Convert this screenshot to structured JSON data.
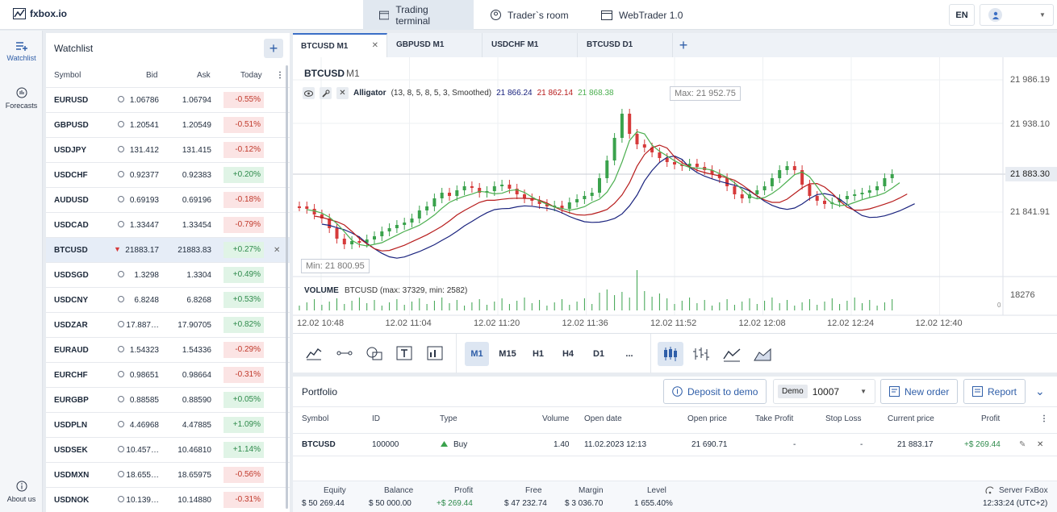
{
  "app": {
    "brand": "fxbox.io"
  },
  "nav": {
    "trading": "Trading terminal",
    "trader_room": "Trader`s room",
    "webtrader": "WebTrader 1.0"
  },
  "header": {
    "lang": "EN"
  },
  "rail": {
    "watchlist": "Watchlist",
    "forecasts": "Forecasts",
    "about": "About us"
  },
  "watchlist": {
    "title": "Watchlist",
    "columns": {
      "symbol": "Symbol",
      "bid": "Bid",
      "ask": "Ask",
      "today": "Today"
    },
    "rows": [
      {
        "symbol": "EURUSD",
        "bid": "1.06786",
        "ask": "1.06794",
        "change": "-0.55%",
        "dir": "neg"
      },
      {
        "symbol": "GBPUSD",
        "bid": "1.20541",
        "ask": "1.20549",
        "change": "-0.51%",
        "dir": "neg"
      },
      {
        "symbol": "USDJPY",
        "bid": "131.412",
        "ask": "131.415",
        "change": "-0.12%",
        "dir": "neg"
      },
      {
        "symbol": "USDCHF",
        "bid": "0.92377",
        "ask": "0.92383",
        "change": "+0.20%",
        "dir": "pos"
      },
      {
        "symbol": "AUDUSD",
        "bid": "0.69193",
        "ask": "0.69196",
        "change": "-0.18%",
        "dir": "neg"
      },
      {
        "symbol": "USDCAD",
        "bid": "1.33447",
        "ask": "1.33454",
        "change": "-0.79%",
        "dir": "neg"
      },
      {
        "symbol": "BTCUSD",
        "bid": "21883.17",
        "ask": "21883.83",
        "change": "+0.27%",
        "dir": "pos"
      },
      {
        "symbol": "USDSGD",
        "bid": "1.3298",
        "ask": "1.3304",
        "change": "+0.49%",
        "dir": "pos"
      },
      {
        "symbol": "USDCNY",
        "bid": "6.8248",
        "ask": "6.8268",
        "change": "+0.53%",
        "dir": "pos"
      },
      {
        "symbol": "USDZAR",
        "bid": "17.887…",
        "ask": "17.90705",
        "change": "+0.82%",
        "dir": "pos"
      },
      {
        "symbol": "EURAUD",
        "bid": "1.54323",
        "ask": "1.54336",
        "change": "-0.29%",
        "dir": "neg"
      },
      {
        "symbol": "EURCHF",
        "bid": "0.98651",
        "ask": "0.98664",
        "change": "-0.31%",
        "dir": "neg"
      },
      {
        "symbol": "EURGBP",
        "bid": "0.88585",
        "ask": "0.88590",
        "change": "+0.05%",
        "dir": "pos"
      },
      {
        "symbol": "USDPLN",
        "bid": "4.46968",
        "ask": "4.47885",
        "change": "+1.09%",
        "dir": "pos"
      },
      {
        "symbol": "USDSEK",
        "bid": "10.457…",
        "ask": "10.46810",
        "change": "+1.14%",
        "dir": "pos"
      },
      {
        "symbol": "USDMXN",
        "bid": "18.655…",
        "ask": "18.65975",
        "change": "-0.56%",
        "dir": "neg"
      },
      {
        "symbol": "USDNOK",
        "bid": "10.139…",
        "ask": "10.14880",
        "change": "-0.31%",
        "dir": "neg"
      }
    ]
  },
  "chart_tabs": [
    "BTCUSD M1",
    "GBPUSD M1",
    "USDCHF M1",
    "BTCUSD D1"
  ],
  "chart": {
    "symbol": "BTCUSD",
    "timeframe": "M1",
    "indicator": {
      "name": "Alligator",
      "params": "(13, 8, 5, 8, 5, 3, Smoothed)",
      "v1": "21 866.24",
      "v2": "21 862.14",
      "v3": "21 868.38"
    },
    "max_label": "Max: 21 952.75",
    "min_label": "Min: 21 800.95",
    "price_ticks": [
      "21 986.19",
      "21 938.10",
      "21 883.30",
      "21 841.91"
    ],
    "volume_label": "VOLUME",
    "volume_info": "BTCUSD (max: 37329, min: 2582)",
    "volume_tick": "18276",
    "volume_zero": "0",
    "time_ticks": [
      "12.02 10:48",
      "12.02 11:04",
      "12.02 11:20",
      "12.02 11:36",
      "12.02 11:52",
      "12.02 12:08",
      "12.02 12:24",
      "12.02 12:40"
    ],
    "colors": {
      "up": "#3aa24c",
      "down": "#d63a3a",
      "jaw": "#1a237e",
      "teeth": "#b71c1c",
      "lips": "#4caf50"
    }
  },
  "timeframes": [
    "M1",
    "M15",
    "H1",
    "H4",
    "D1",
    "..."
  ],
  "portfolio": {
    "title": "Portfolio",
    "deposit": "Deposit to demo",
    "account_type": "Demo",
    "account_id": "10007",
    "new_order": "New order",
    "report": "Report",
    "columns": [
      "Symbol",
      "ID",
      "Type",
      "Volume",
      "Open date",
      "Open price",
      "Take Profit",
      "Stop Loss",
      "Current price",
      "Profit"
    ],
    "row": {
      "symbol": "BTCUSD",
      "id": "100000",
      "type": "Buy",
      "volume": "1.40",
      "open_date": "11.02.2023 12:13",
      "open_price": "21 690.71",
      "tp": "-",
      "sl": "-",
      "current": "21 883.17",
      "profit": "+$ 269.44"
    },
    "footer": {
      "equity_l": "Equity",
      "equity": "$ 50 269.44",
      "balance_l": "Balance",
      "balance": "$ 50 000.00",
      "profit_l": "Profit",
      "profit": "+$ 269.44",
      "free_l": "Free",
      "free": "$ 47 232.74",
      "margin_l": "Margin",
      "margin": "$ 3 036.70",
      "level_l": "Level",
      "level": "1 655.40%",
      "server": "Server FxBox",
      "time": "12:33:24 (UTC+2)"
    }
  }
}
